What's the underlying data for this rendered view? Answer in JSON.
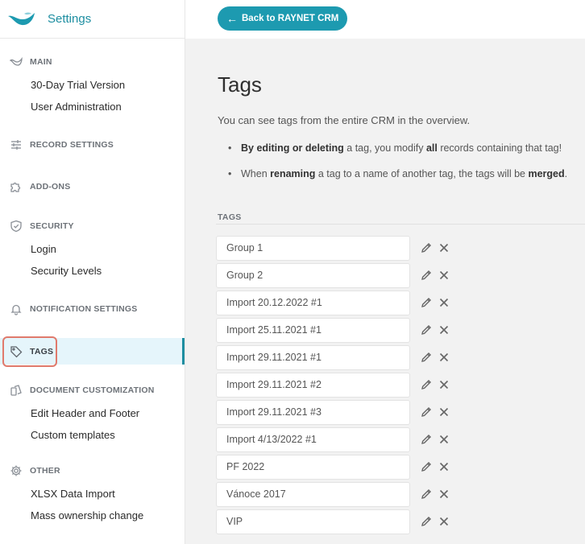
{
  "app": {
    "title": "Settings"
  },
  "topbar": {
    "back_label": "Back to RAYNET CRM"
  },
  "sidebar": {
    "sections": [
      {
        "title": "MAIN",
        "icon": "logo-icon",
        "items": [
          "30-Day Trial Version",
          "User Administration"
        ]
      },
      {
        "title": "RECORD SETTINGS",
        "icon": "sliders-icon",
        "items": []
      },
      {
        "title": "ADD-ONS",
        "icon": "puzzle-icon",
        "items": []
      },
      {
        "title": "SECURITY",
        "icon": "shield-icon",
        "items": [
          "Login",
          "Security Levels"
        ]
      },
      {
        "title": "NOTIFICATION SETTINGS",
        "icon": "bell-icon",
        "items": []
      },
      {
        "title": "TAGS",
        "icon": "tag-icon",
        "items": [],
        "active": true
      },
      {
        "title": "DOCUMENT CUSTOMIZATION",
        "icon": "documents-icon",
        "items": [
          "Edit Header and Footer",
          "Custom templates"
        ]
      },
      {
        "title": "OTHER",
        "icon": "gear-icon",
        "items": [
          "XLSX Data Import",
          "Mass ownership change"
        ]
      }
    ]
  },
  "main": {
    "title": "Tags",
    "description": "You can see tags from the entire CRM in the overview.",
    "bullet1": {
      "b1": "By editing or deleting",
      "t1": " a tag, you modify ",
      "b2": "all",
      "t2": " records containing that tag!"
    },
    "bullet2": {
      "t1": "When ",
      "b1": "renaming",
      "t2": " a tag to a name of another tag, the tags will be ",
      "b2": "merged",
      "t3": "."
    },
    "tags_label": "TAGS",
    "tags": [
      "Group 1",
      "Group 2",
      "Import 20.12.2022 #1",
      "Import 25.11.2021 #1",
      "Import 29.11.2021 #1",
      "Import 29.11.2021 #2",
      "Import 29.11.2021 #3",
      "Import 4/13/2022 #1",
      "PF 2022",
      "Vánoce 2017",
      "VIP"
    ]
  },
  "colors": {
    "accent": "#1d9ab0",
    "active_bg": "#e5f5fb",
    "highlight": "#e07a6c"
  }
}
